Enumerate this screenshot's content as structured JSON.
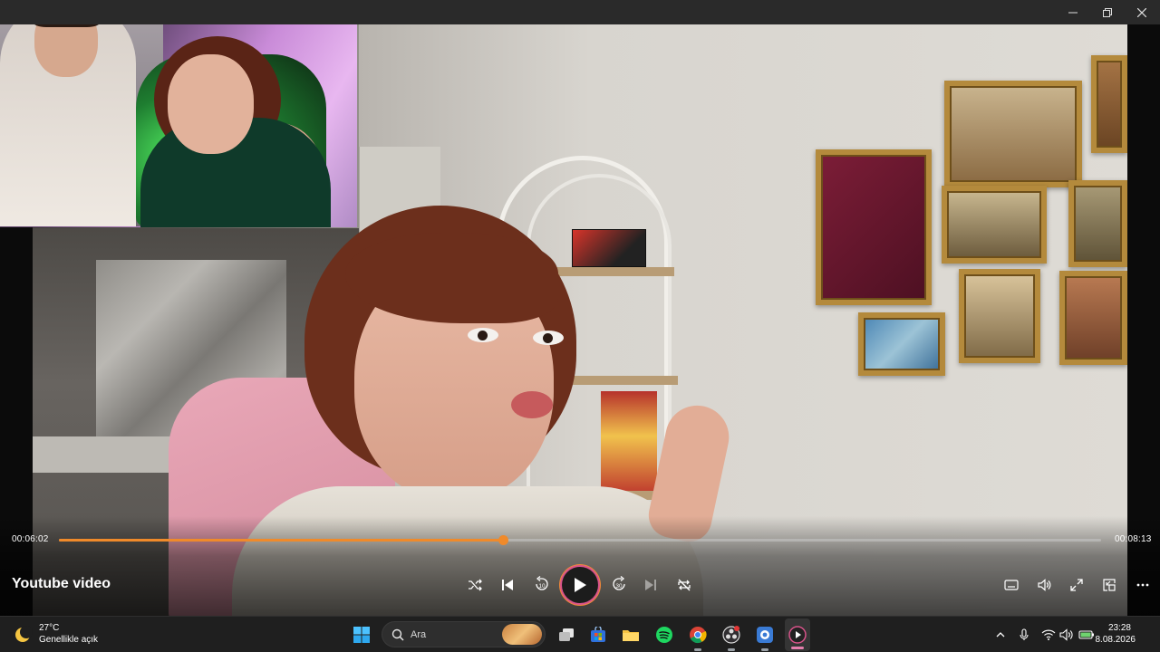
{
  "window": {
    "controls": [
      "minimize",
      "restore",
      "close"
    ]
  },
  "player": {
    "title": "Youtube video",
    "elapsed": "00:06:02",
    "duration": "00:08:13",
    "progress_fraction": 0.426,
    "accent_color": "#f08a2a",
    "controls": {
      "left": [
        "shuffle-icon",
        "previous-icon",
        "rewind-10-icon",
        "play-icon",
        "forward-30-icon",
        "next-icon",
        "repeat-off-icon"
      ],
      "right": [
        "subtitles-icon",
        "volume-icon",
        "fullscreen-icon",
        "mini-player-icon",
        "more-icon"
      ],
      "rewind_seconds": "10",
      "forward_seconds": "30"
    }
  },
  "taskbar": {
    "weather": {
      "temperature": "27°C",
      "description": "Genellikle açık"
    },
    "search": {
      "placeholder": "Ara"
    },
    "pinned": [
      "windows-start-icon",
      "search-icon",
      "task-view-icon",
      "microsoft-store-icon",
      "file-explorer-icon",
      "spotify-icon",
      "chrome-icon",
      "obs-icon",
      "app-icon",
      "media-player-icon"
    ],
    "tray": [
      "chevron-up-icon",
      "microphone-icon",
      "wifi-icon",
      "speaker-icon",
      "battery-icon"
    ],
    "clock": {
      "time": "23:28",
      "date": "8.08.2026"
    }
  }
}
